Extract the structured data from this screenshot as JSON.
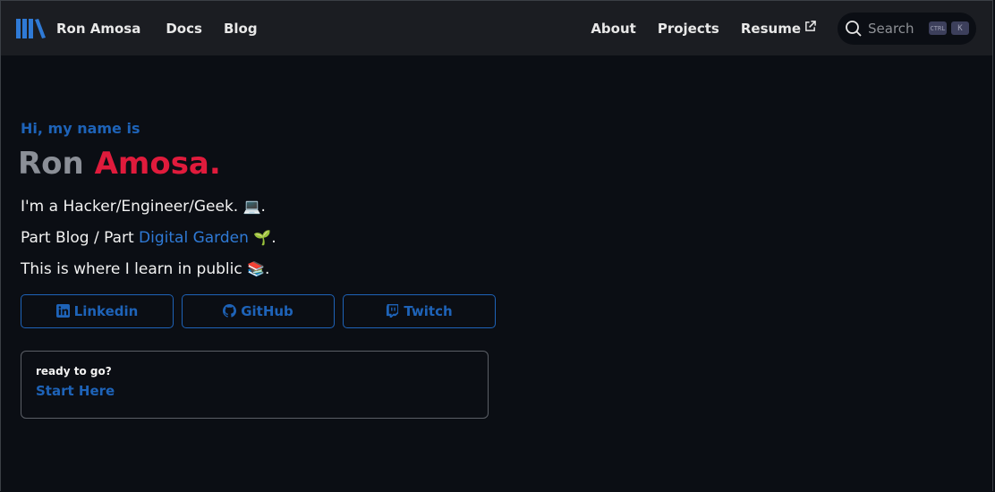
{
  "nav": {
    "brand": "Ron Amosa",
    "links": [
      "Docs",
      "Blog"
    ],
    "right_links": [
      "About",
      "Projects",
      "Resume"
    ],
    "search_placeholder": "Search",
    "kbd_ctrl": "CTRL",
    "kbd_k": "K"
  },
  "hero": {
    "greeting": "Hi, my name is",
    "first_name": "Ron",
    "last_name": "Amosa.",
    "line1_text": "I'm a Hacker/Engineer/Geek.",
    "line1_emoji": "💻",
    "line1_end": ".",
    "line2_pre": "Part Blog / Part",
    "line2_link": "Digital Garden",
    "line2_emoji": "🌱",
    "line2_end": ".",
    "line3_text": "This is where I learn in public",
    "line3_emoji": "📚",
    "line3_end": "."
  },
  "buttons": {
    "linkedin": "Linkedin",
    "github": "GitHub",
    "twitch": "Twitch"
  },
  "card": {
    "subtitle": "ready to go?",
    "link": "Start Here"
  },
  "colors": {
    "accent": "#1e63b8",
    "name_red": "#e01b3c",
    "background": "#0b0e14",
    "navbar": "#1b1d22"
  }
}
